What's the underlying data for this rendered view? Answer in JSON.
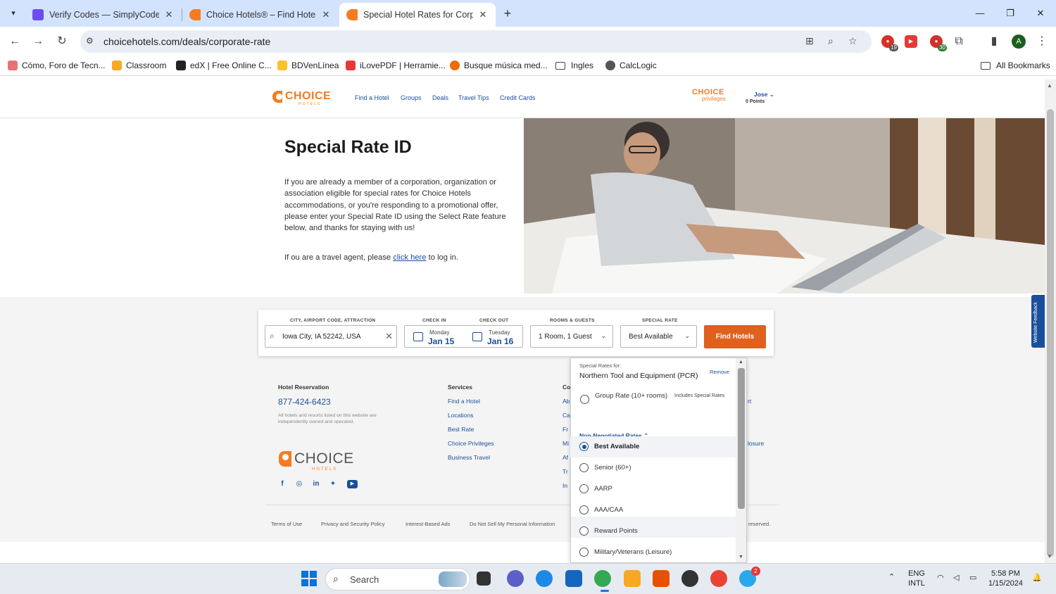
{
  "browser": {
    "tabs": [
      {
        "title": "Verify Codes — SimplyCodes",
        "color": "#6a4df0"
      },
      {
        "title": "Choice Hotels® – Find Hotel Ro",
        "color": "#f57c20"
      },
      {
        "title": "Special Hotel Rates for Corpora",
        "color": "#f57c20"
      }
    ],
    "url": "choicehotels.com/deals/corporate-rate",
    "profile_initial": "A",
    "ext_badge_1": "19",
    "ext_badge_2": "30",
    "bookmarks": [
      "Cómo, Foro de Tecn...",
      "Classroom",
      "edX | Free Online C...",
      "BDVenLínea",
      "iLovePDF | Herramie...",
      "Busque música med...",
      "Ingles",
      "CalcLogic"
    ],
    "all_bookmarks": "All Bookmarks"
  },
  "site": {
    "logo_word": "CHOICE",
    "logo_sub": "HOTELS",
    "nav": [
      "Find a Hotel",
      "Groups",
      "Deals",
      "Travel Tips",
      "Credit Cards"
    ],
    "privileges_word": "CHOICE",
    "privileges_sub": "privileges",
    "user": "Jose",
    "points": "0 Points"
  },
  "hero": {
    "title": "Special Rate ID",
    "paragraph": "If you are already a member of a corporation, organization or association eligible for special rates for Choice Hotels accommodations, or you're responding to a promotional offer, please enter your Special Rate ID using the Select Rate feature below, and thanks for staying with us!",
    "agent_prefix": "If ou are a travel agent, please",
    "agent_link": "click here",
    "agent_suffix": "to log in."
  },
  "search": {
    "city_label": "CITY, AIRPORT CODE, ATTRACTION",
    "city_value": "Iowa City, IA 52242, USA",
    "checkin_label": "CHECK IN",
    "checkin_day": "Monday",
    "checkin_date": "Jan 15",
    "checkout_label": "CHECK OUT",
    "checkout_day": "Tuesday",
    "checkout_date": "Jan 16",
    "rooms_label": "ROOMS & GUESTS",
    "rooms_value": "1 Room, 1 Guest",
    "rate_label": "SPECIAL RATE",
    "rate_value": "Best Available",
    "find_button": "Find Hotels"
  },
  "dropdown": {
    "for_label": "Special Rates for:",
    "corporation": "Northern Tool and Equipment (PCR)",
    "remove": "Remove",
    "group_rate": "Group Rate (10+ rooms)",
    "group_note": "Includes Special Rates",
    "section": "Non-Negotiated Rates",
    "options": [
      {
        "label": "Best Available",
        "selected": true
      },
      {
        "label": "Senior (60+)",
        "selected": false
      },
      {
        "label": "AARP",
        "selected": false
      },
      {
        "label": "AAA/CAA",
        "selected": false
      },
      {
        "label": "Reward Points",
        "selected": false
      },
      {
        "label": "Military/Veterans (Leisure)",
        "selected": false
      }
    ]
  },
  "footer": {
    "reservation_head": "Hotel Reservation",
    "phone": "877-424-6423",
    "disclaimer": "All hotels and resorts listed on this website are independently owned and operated.",
    "services_head": "Services",
    "services": [
      "Find a Hotel",
      "Locations",
      "Best Rate",
      "Choice Privileges",
      "Business Travel"
    ],
    "col3_head": "Co",
    "col3_items": [
      "Ab",
      "Ca",
      "Fr",
      "Mi",
      "Af",
      "Tr",
      "In"
    ],
    "col4_items": [
      "rt",
      "losure"
    ],
    "legal": [
      "Terms of Use",
      "Privacy and Security Policy",
      "Interest-Based Ads",
      "Do Not Sell My Personal Information"
    ],
    "rights": "reserved."
  },
  "feedback": "Website Feedback",
  "taskbar": {
    "search": "Search",
    "lang1": "ENG",
    "lang2": "INTL",
    "time": "5:58 PM",
    "date": "1/15/2024",
    "telegram_badge": "2"
  },
  "colors": {
    "brand_orange": "#f57c20",
    "brand_blue": "#1a4f9c",
    "find_button": "#e0601d"
  }
}
